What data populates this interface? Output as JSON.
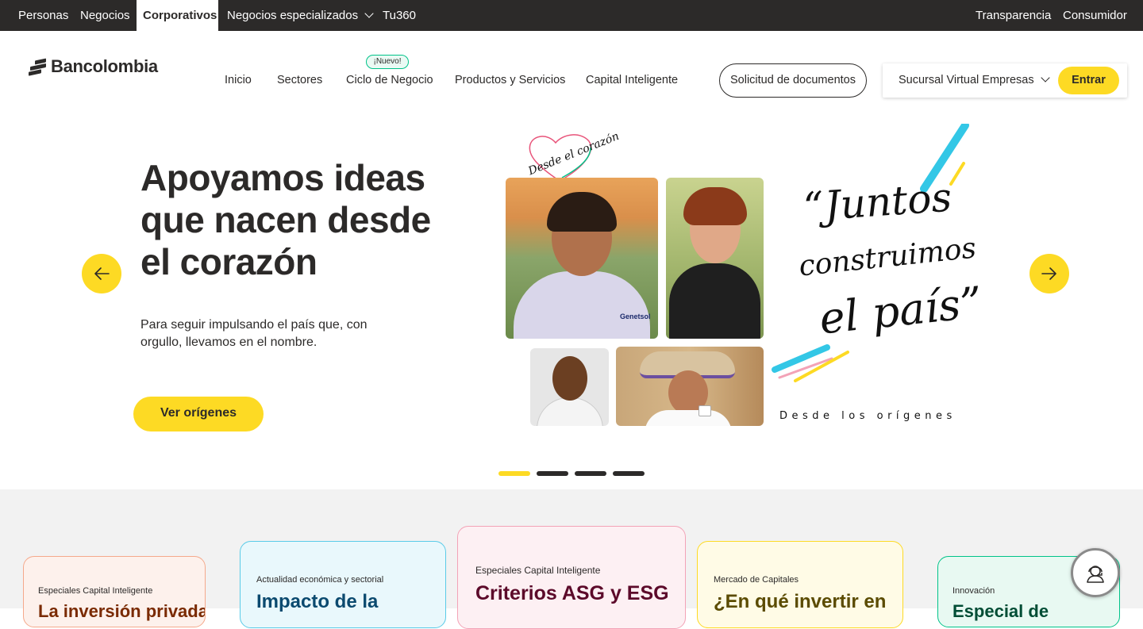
{
  "topbar": {
    "items": [
      "Personas",
      "Negocios",
      "Corporativos",
      "Negocios especializados",
      "Tu360"
    ],
    "right_items": [
      "Transparencia",
      "Consumidor"
    ]
  },
  "header": {
    "logo_text": "Bancolombia",
    "nav": [
      "Inicio",
      "Sectores",
      "Ciclo de Negocio",
      "Productos y Servicios",
      "Capital Inteligente"
    ],
    "new_badge": "¡Nuevo!",
    "docs_button": "Solicitud de documentos",
    "sucursal_label": "Sucursal Virtual Empresas",
    "login_button": "Entrar"
  },
  "hero": {
    "title": "Apoyamos ideas que nacen desde el corazón",
    "subtitle": "Para seguir impulsando el país que, con orgullo, llevamos en el nombre.",
    "cta": "Ver orígenes",
    "image": {
      "heart_text": "Desde el corazón",
      "quote_line1": "“Juntos",
      "quote_line2": "construimos",
      "quote_line3": "el país”",
      "shirt_logo": "Genetsol",
      "footer": "Desde los orígenes"
    },
    "slides_total": 4,
    "active_slide": 1
  },
  "cards": [
    {
      "category": "Especiales Capital Inteligente",
      "title": "La inversión privada",
      "border": "#f5a98b",
      "bg": "#fdf1ec",
      "title_color": "#7a2a00"
    },
    {
      "category": "Actualidad económica y sectorial",
      "title": "Impacto de la",
      "border": "#59cbe8",
      "bg": "#e9f8fc",
      "title_color": "#0b4a6f"
    },
    {
      "category": "Especiales Capital Inteligente",
      "title": "Criterios ASG y ESG",
      "border": "#f3a3b7",
      "bg": "#fdf0f3",
      "title_color": "#5c0a2a"
    },
    {
      "category": "Mercado de Capitales",
      "title": "¿En qué invertir en",
      "border": "#fdda24",
      "bg": "#fffbe6",
      "title_color": "#5b4b00"
    },
    {
      "category": "Innovación",
      "title": "Especial de",
      "border": "#00c389",
      "bg": "#e8f9f2",
      "title_color": "#004d35"
    }
  ],
  "colors": {
    "brand_yellow": "#fdda24",
    "dark": "#2c2a29",
    "topbar_bg": "#2c2a29",
    "section_bg": "#f2f2f2"
  },
  "icons": {
    "prev": "arrow-left-icon",
    "next": "arrow-right-icon",
    "help": "support-agent-icon",
    "dropdown": "chevron-down-icon"
  }
}
